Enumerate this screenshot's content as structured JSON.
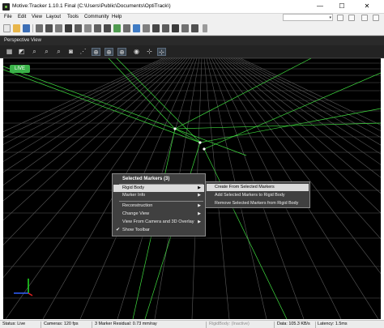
{
  "window": {
    "title": "Motive:Tracker 1.10.1 Final  (C:\\Users\\Public\\Documents\\OptiTrack\\)",
    "app_icon": "optitrack-app-icon",
    "controls": [
      "minimize-icon",
      "maximize-icon",
      "close-icon"
    ],
    "minimize_glyph": "—",
    "maximize_glyph": "☐",
    "close_glyph": "✕"
  },
  "menubar": {
    "items": [
      {
        "label": "File"
      },
      {
        "label": "Edit"
      },
      {
        "label": "View"
      },
      {
        "label": "Layout"
      },
      {
        "label": "Tools"
      },
      {
        "label": "Community"
      },
      {
        "label": "Help"
      }
    ],
    "combo_value": "",
    "combo_arrow": "▾"
  },
  "toolbar": {
    "icons": [
      "new-file-icon",
      "open-folder-icon",
      "save-icon",
      "settings-tools-icon",
      "grid-icon",
      "panels-icon",
      "camera-icon",
      "layout-icon",
      "ruler-icon",
      "calibration-wand-icon",
      "chart-icon",
      "rigid-body-icon",
      "skeleton-icon",
      "marker-set-icon",
      "camera-preview-icon",
      "reference-icon",
      "data-icon",
      "timeline-icon",
      "properties-icon",
      "project-icon",
      "overflow-chevron-icon"
    ]
  },
  "panel": {
    "title": "Perspective View"
  },
  "view_toolbar": {
    "buttons": [
      {
        "icon": "view-grid-icon",
        "glyph": "▦",
        "active": false
      },
      {
        "icon": "camera-view-icon",
        "glyph": "◩",
        "active": false
      },
      {
        "icon": "zoom-icon",
        "glyph": "⌕",
        "active": false
      },
      {
        "icon": "zoom-fit-icon",
        "glyph": "⌕",
        "active": false
      },
      {
        "icon": "zoom-selected-icon",
        "glyph": "⌕",
        "active": false
      },
      {
        "icon": "snapshot-camera-icon",
        "glyph": "◙",
        "active": false
      },
      {
        "icon": "share-icon",
        "glyph": "⋰",
        "active": false
      },
      {
        "icon": "tracking-mode-icon",
        "glyph": "⊕",
        "active": true
      },
      {
        "icon": "marker-mode-icon",
        "glyph": "⊕",
        "active": true
      },
      {
        "icon": "skeleton-mode-icon",
        "glyph": "⊕",
        "active": true
      },
      {
        "icon": "visibility-eye-icon",
        "glyph": "◉",
        "active": false
      },
      {
        "icon": "pivot-icon",
        "glyph": "⊹",
        "active": false
      },
      {
        "icon": "rigid-body-pivot-icon",
        "glyph": "⊹",
        "active": true
      }
    ]
  },
  "viewport": {
    "live_badge": "LIVE",
    "grid_color": "#5a5a5a",
    "ray_color": "#3fdc3f",
    "axis_colors": {
      "x": "#e02020",
      "y": "#20e020",
      "z": "#3060ff"
    }
  },
  "context_menu": {
    "header": "Selected Markers (3)",
    "items": [
      {
        "label": "Rigid Body",
        "submenu": true,
        "highlighted": true
      },
      {
        "label": "Marker Info",
        "submenu": true
      },
      {
        "label": "Reconstruction",
        "submenu": true
      },
      {
        "label": "Change View",
        "submenu": true
      },
      {
        "label": "View From Camera and 3D Overlay",
        "submenu": true
      },
      {
        "label": "Show Toolbar",
        "checked": true
      }
    ],
    "submenu_arrow": "▶",
    "check_glyph": "✔"
  },
  "submenu": {
    "items": [
      {
        "label": "Create From Selected Markers",
        "highlighted": true
      },
      {
        "label": "Add Selected Markers to Rigid Body"
      },
      {
        "label": "Remove Selected Markers from Rigid Body"
      }
    ]
  },
  "statusbar": {
    "status": "Status: Live",
    "cameras": "Cameras: 120 fps",
    "residual": "3 Marker Residual: 0.73 mm/ray",
    "rigidbody": "RigidBody: (Inactive)",
    "data": "Data: 105.3 KB/s",
    "latency": "Latency: 1.5ms"
  }
}
